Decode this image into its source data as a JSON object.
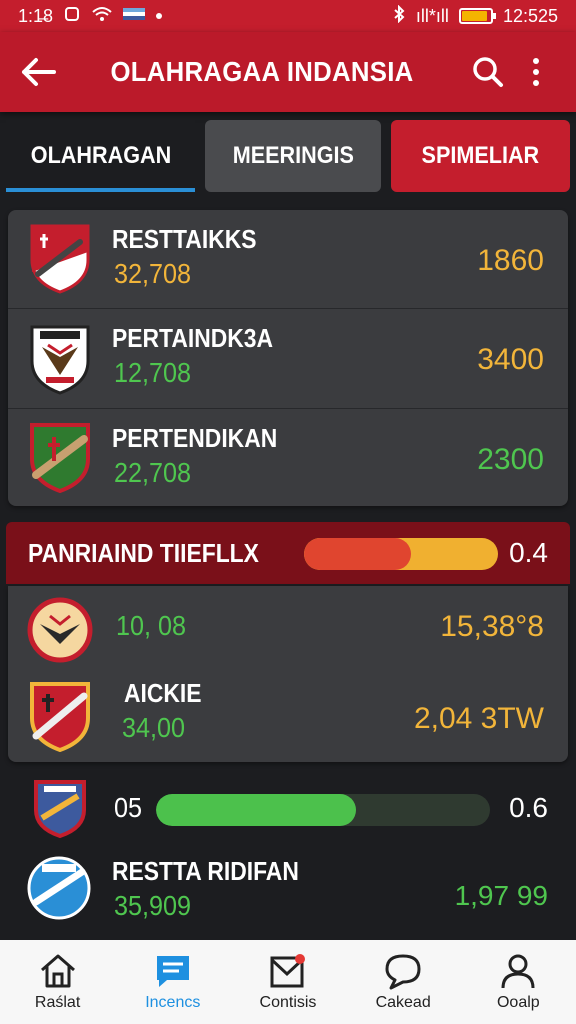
{
  "status_bar": {
    "time": "1:1̶8",
    "time_right": "12:525",
    "signal_text": "ıll*ıll"
  },
  "app_bar": {
    "title": "OLAHRAGAA INDANSIA"
  },
  "tabs": [
    {
      "label": "OLAHRAGAN"
    },
    {
      "label": "MEERINGIS"
    },
    {
      "label": "SPIMELIAR"
    }
  ],
  "leaderboard": [
    {
      "name": "RESTTAIKKS",
      "sub": "32,708",
      "value": "1860"
    },
    {
      "name": "PERTAINDK3A",
      "sub": "12,708",
      "value": "3400"
    },
    {
      "name": "PERTENDIKAN",
      "sub": "22,708",
      "value": "2300"
    }
  ],
  "section": {
    "title": "PANRIAIND TIIEFLLX",
    "value": "0.4",
    "progress": 0.55
  },
  "match_card": [
    {
      "name": "",
      "sub": "10, 08",
      "value": "15,38°8"
    },
    {
      "name": "AICKIE",
      "sub": "34,00",
      "value": "2,04 3TW"
    }
  ],
  "bottom_rows": {
    "bar_label": "05",
    "bar_value": "0.6",
    "bar_progress": 0.6,
    "team_name": "RESTTA RIDIFAN",
    "team_sub": "35,909",
    "team_value": "1,97 99"
  },
  "bottom_nav": [
    {
      "label": "Raślat",
      "icon": "home-icon"
    },
    {
      "label": "Incencs",
      "icon": "chat-icon"
    },
    {
      "label": "Contisis",
      "icon": "mail-icon"
    },
    {
      "label": "Cakead",
      "icon": "bubble-icon"
    },
    {
      "label": "Ooalp",
      "icon": "user-icon"
    }
  ],
  "colors": {
    "primary_red": "#c41e2d",
    "tab_accent": "#2a8fd6",
    "value_yellow": "#f2b53a",
    "value_green": "#4fc64f"
  }
}
